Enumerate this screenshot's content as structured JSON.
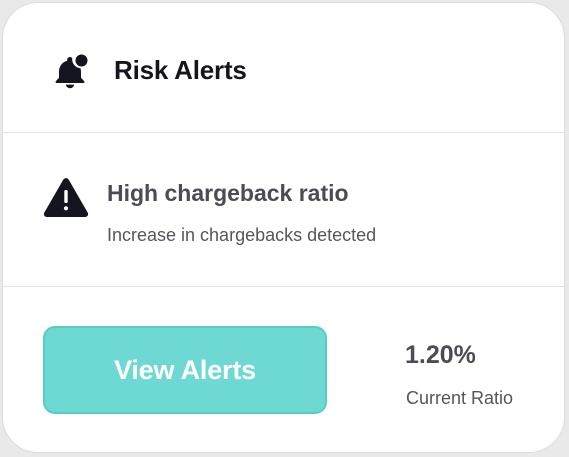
{
  "header": {
    "icon": "bell-alert-icon",
    "title": "Risk Alerts"
  },
  "alert": {
    "icon": "warning-triangle-icon",
    "title": "High chargeback ratio",
    "description": "Increase in chargebacks detected"
  },
  "footer": {
    "button_label": "View Alerts",
    "ratio_value": "1.20%",
    "ratio_label": "Current Ratio"
  },
  "colors": {
    "accent": "#6ed9d3",
    "title_text": "#15151f",
    "body_text": "#4c4c54"
  }
}
